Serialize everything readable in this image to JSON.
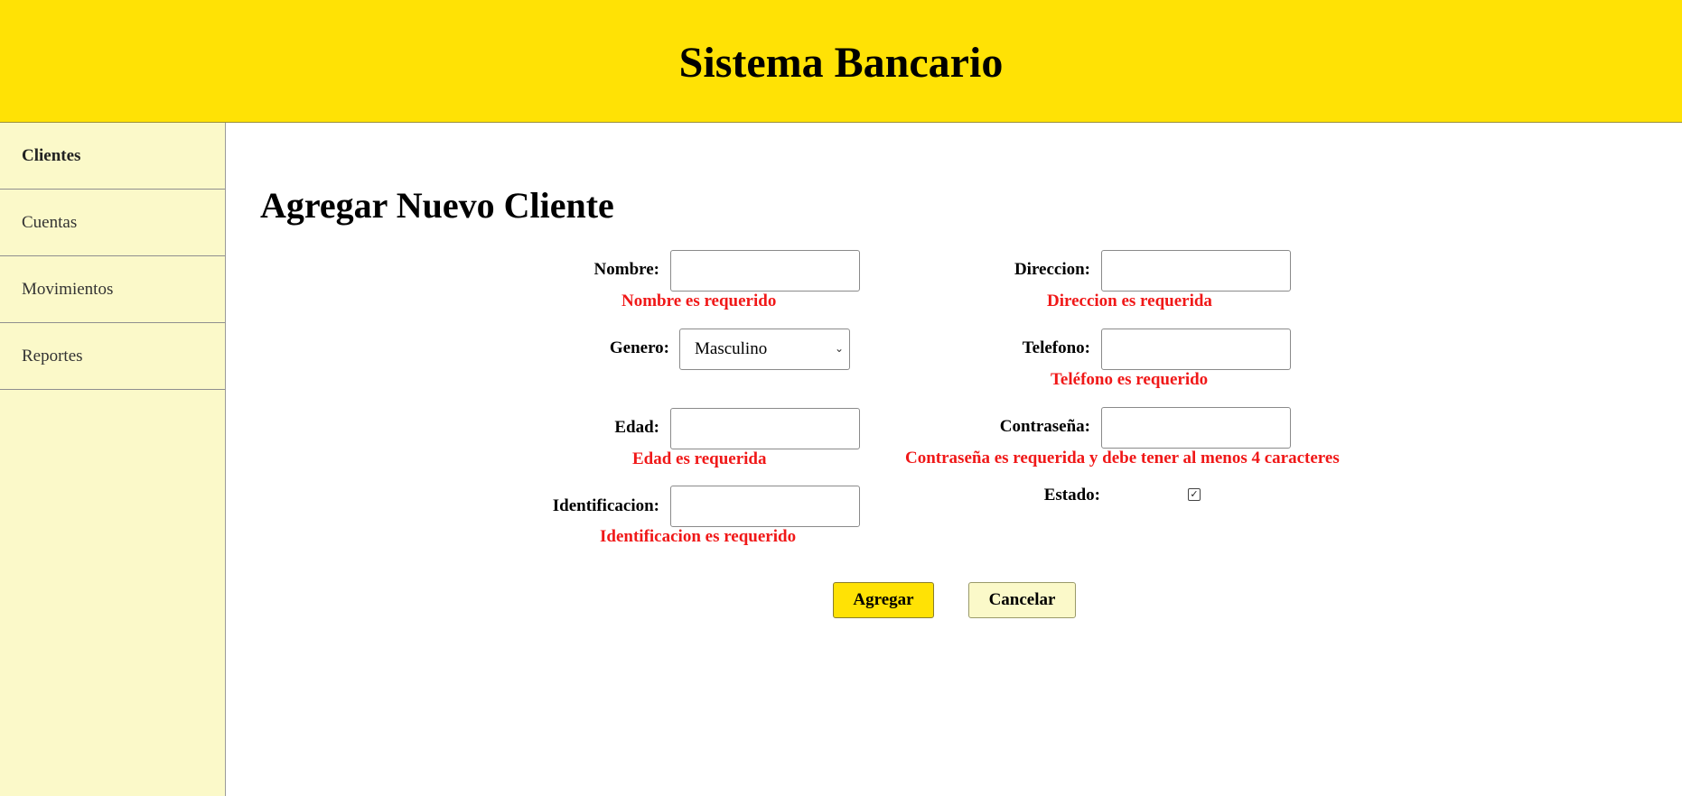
{
  "header": {
    "title": "Sistema Bancario"
  },
  "sidebar": {
    "items": [
      {
        "label": "Clientes",
        "active": true
      },
      {
        "label": "Cuentas",
        "active": false
      },
      {
        "label": "Movimientos",
        "active": false
      },
      {
        "label": "Reportes",
        "active": false
      }
    ]
  },
  "main": {
    "title": "Agregar Nuevo Cliente",
    "form": {
      "nombre": {
        "label": "Nombre:",
        "value": "",
        "error": "Nombre es requerido"
      },
      "genero": {
        "label": "Genero:",
        "selected": "Masculino"
      },
      "edad": {
        "label": "Edad:",
        "value": "",
        "error": "Edad es requerida"
      },
      "identificacion": {
        "label": "Identificacion:",
        "value": "",
        "error": "Identificacion es requerido"
      },
      "direccion": {
        "label": "Direccion:",
        "value": "",
        "error": "Direccion es requerida"
      },
      "telefono": {
        "label": "Telefono:",
        "value": "",
        "error": "Teléfono es requerido"
      },
      "contrasena": {
        "label": "Contraseña:",
        "value": "",
        "error": "Contraseña es requerida y debe tener al menos 4 caracteres"
      },
      "estado": {
        "label": "Estado:",
        "checked": true
      }
    },
    "buttons": {
      "agregar": "Agregar",
      "cancelar": "Cancelar"
    }
  },
  "colors": {
    "header_bg": "#ffe205",
    "sidebar_bg": "#fbf9c9",
    "error": "#f01818"
  },
  "icons": {
    "select_chevron": "chevron-down-icon",
    "estado_checkbox": "checkmark-icon"
  }
}
